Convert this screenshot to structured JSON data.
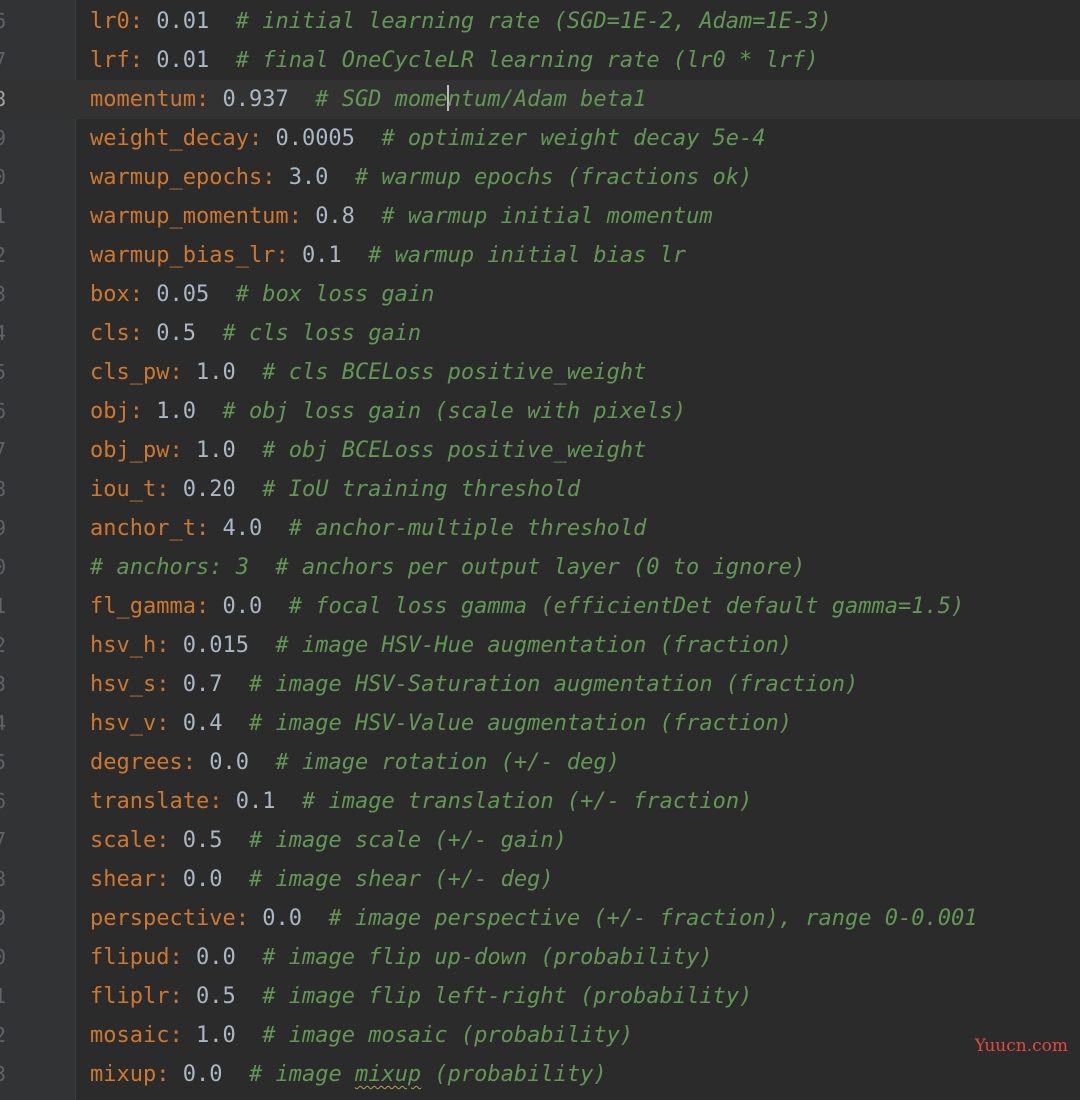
{
  "editor": {
    "current_line_number": "8",
    "lines": [
      {
        "num": "6",
        "key": "lr0",
        "value": "0.01",
        "comment": "# initial learning rate (SGD=1E-2, Adam=1E-3)"
      },
      {
        "num": "7",
        "key": "lrf",
        "value": "0.01",
        "comment": "# final OneCycleLR learning rate (lr0 * lrf)"
      },
      {
        "num": "8",
        "key": "momentum",
        "value": "0.937",
        "comment_a": "# SGD mome",
        "comment_b": "ntum/Adam beta1"
      },
      {
        "num": "9",
        "key": "weight_decay",
        "value": "0.0005",
        "comment": "# optimizer weight decay 5e-4"
      },
      {
        "num": "0",
        "key": "warmup_epochs",
        "value": "3.0",
        "comment": "# warmup epochs (fractions ok)"
      },
      {
        "num": "1",
        "key": "warmup_momentum",
        "value": "0.8",
        "comment": "# warmup initial momentum"
      },
      {
        "num": "2",
        "key": "warmup_bias_lr",
        "value": "0.1",
        "comment": "# warmup initial bias lr"
      },
      {
        "num": "3",
        "key": "box",
        "value": "0.05",
        "comment": "# box loss gain"
      },
      {
        "num": "4",
        "key": "cls",
        "value": "0.5",
        "comment": "# cls loss gain"
      },
      {
        "num": "5",
        "key": "cls_pw",
        "value": "1.0",
        "comment": "# cls BCELoss positive_weight"
      },
      {
        "num": "6",
        "key": "obj",
        "value": "1.0",
        "comment": "# obj loss gain (scale with pixels)"
      },
      {
        "num": "7",
        "key": "obj_pw",
        "value": "1.0",
        "comment": "# obj BCELoss positive_weight"
      },
      {
        "num": "8",
        "key": "iou_t",
        "value": "0.20",
        "comment": "# IoU training threshold"
      },
      {
        "num": "9",
        "key": "anchor_t",
        "value": "4.0",
        "comment": "# anchor-multiple threshold"
      },
      {
        "num": "0",
        "full_comment": "# anchors: 3  # anchors per output layer (0 to ignore)"
      },
      {
        "num": "1",
        "key": "fl_gamma",
        "value": "0.0",
        "comment": "# focal loss gamma (efficientDet default gamma=1.5)"
      },
      {
        "num": "2",
        "key": "hsv_h",
        "value": "0.015",
        "comment": "# image HSV-Hue augmentation (fraction)"
      },
      {
        "num": "3",
        "key": "hsv_s",
        "value": "0.7",
        "comment": "# image HSV-Saturation augmentation (fraction)"
      },
      {
        "num": "4",
        "key": "hsv_v",
        "value": "0.4",
        "comment": "# image HSV-Value augmentation (fraction)"
      },
      {
        "num": "5",
        "key": "degrees",
        "value": "0.0",
        "comment": "# image rotation (+/- deg)"
      },
      {
        "num": "6",
        "key": "translate",
        "value": "0.1",
        "comment": "# image translation (+/- fraction)"
      },
      {
        "num": "7",
        "key": "scale",
        "value": "0.5",
        "comment": "# image scale (+/- gain)"
      },
      {
        "num": "8",
        "key": "shear",
        "value": "0.0",
        "comment": "# image shear (+/- deg)"
      },
      {
        "num": "9",
        "key": "perspective",
        "value": "0.0",
        "comment": "# image perspective (+/- fraction), range 0-0.001"
      },
      {
        "num": "0",
        "key": "flipud",
        "value": "0.0",
        "comment": "# image flip up-down (probability)"
      },
      {
        "num": "1",
        "key": "fliplr",
        "value": "0.5",
        "comment": "# image flip left-right (probability)"
      },
      {
        "num": "2",
        "key": "mosaic",
        "value": "1.0",
        "comment": "# image mosaic (probability)"
      },
      {
        "num": "3",
        "key": "mixup",
        "value": "0.0",
        "comment_a": "# image ",
        "comment_squiggle": "mixup",
        "comment_b": " (probability)"
      }
    ]
  },
  "watermark": "Yuucn.com",
  "colors": {
    "background": "#2b2b2b",
    "key": "#cc7832",
    "value": "#a9b7c6",
    "comment": "#629755",
    "line_number": "#606366"
  }
}
